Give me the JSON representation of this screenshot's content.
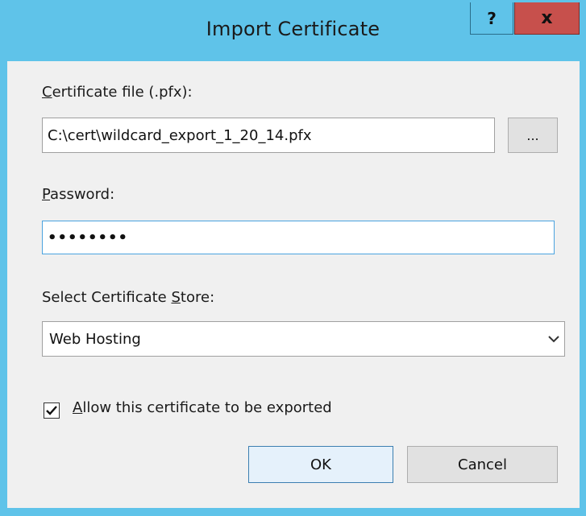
{
  "window": {
    "title": "Import Certificate",
    "help_label": "?",
    "close_label": "x"
  },
  "form": {
    "cert_file_label_accel": "C",
    "cert_file_label_rest": "ertificate file (.pfx):",
    "cert_file_value": "C:\\cert\\wildcard_export_1_20_14.pfx",
    "browse_label": "...",
    "password_label_accel": "P",
    "password_label_rest": "assword:",
    "password_value": "••••••••",
    "store_label_pre": "Select Certificate ",
    "store_label_accel": "S",
    "store_label_rest": "tore:",
    "store_value": "Web Hosting",
    "exportable_checked": true,
    "exportable_label_accel": "A",
    "exportable_label_rest": "llow this certificate to be exported"
  },
  "buttons": {
    "ok_label": "OK",
    "cancel_label": "Cancel"
  },
  "colors": {
    "titlebar": "#5fc3e9",
    "close": "#c7504c",
    "client": "#f0f0f0"
  }
}
